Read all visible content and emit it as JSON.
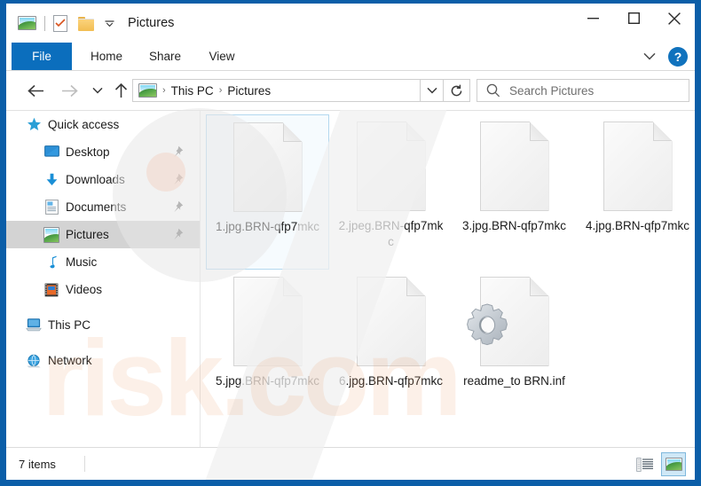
{
  "window": {
    "title": "Pictures",
    "quick_access_toolbar": [
      {
        "name": "pictures-properties-icon",
        "label": "Pictures"
      },
      {
        "name": "properties-icon",
        "label": "Properties"
      },
      {
        "name": "new-folder-icon",
        "label": "New folder"
      },
      {
        "name": "customize-chevron-icon",
        "label": "Customize Quick Access Toolbar"
      }
    ],
    "controls": {
      "minimize": "Minimize",
      "maximize": "Maximize",
      "close": "Close"
    }
  },
  "ribbon": {
    "tabs": [
      {
        "label": "File",
        "selected": true
      },
      {
        "label": "Home",
        "selected": false
      },
      {
        "label": "Share",
        "selected": false
      },
      {
        "label": "View",
        "selected": false
      }
    ],
    "collapse_label": "Minimize the Ribbon",
    "help_label": "?"
  },
  "navigation": {
    "back_label": "Back",
    "forward_label": "Forward",
    "recent_label": "Recent locations",
    "up_label": "Up to This PC",
    "breadcrumbs": [
      "This PC",
      "Pictures"
    ],
    "address_dropdown_label": "Previous locations",
    "refresh_label": "Refresh Pictures",
    "separator": "›"
  },
  "search": {
    "placeholder": "Search Pictures",
    "value": ""
  },
  "sidebar": {
    "items": [
      {
        "label": "Quick access",
        "icon": "star-icon",
        "level": 0,
        "pinned": false,
        "selected": false
      },
      {
        "label": "Desktop",
        "icon": "desktop-icon",
        "level": 1,
        "pinned": true,
        "selected": false
      },
      {
        "label": "Downloads",
        "icon": "downloads-icon",
        "level": 1,
        "pinned": true,
        "selected": false
      },
      {
        "label": "Documents",
        "icon": "documents-icon",
        "level": 1,
        "pinned": true,
        "selected": false
      },
      {
        "label": "Pictures",
        "icon": "pictures-icon",
        "level": 1,
        "pinned": true,
        "selected": true
      },
      {
        "label": "Music",
        "icon": "music-icon",
        "level": 1,
        "pinned": false,
        "selected": false
      },
      {
        "label": "Videos",
        "icon": "videos-icon",
        "level": 1,
        "pinned": false,
        "selected": false
      },
      {
        "label": "This PC",
        "icon": "this-pc-icon",
        "level": 0,
        "pinned": false,
        "selected": false
      },
      {
        "label": "Network",
        "icon": "network-icon",
        "level": 0,
        "pinned": false,
        "selected": false
      }
    ]
  },
  "files": [
    {
      "name": "1.jpg.BRN-qfp7mkc",
      "icon": "blank-document-icon",
      "selected": true
    },
    {
      "name": "2.jpeg.BRN-qfp7mkc",
      "icon": "blank-document-icon",
      "selected": false
    },
    {
      "name": "3.jpg.BRN-qfp7mkc",
      "icon": "blank-document-icon",
      "selected": false
    },
    {
      "name": "4.jpg.BRN-qfp7mkc",
      "icon": "blank-document-icon",
      "selected": false
    },
    {
      "name": "5.jpg.BRN-qfp7mkc",
      "icon": "blank-document-icon",
      "selected": false
    },
    {
      "name": "6.jpg.BRN-qfp7mkc",
      "icon": "blank-document-icon",
      "selected": false
    },
    {
      "name": "readme_to BRN.inf",
      "icon": "inf-gear-document-icon",
      "selected": false
    }
  ],
  "status": {
    "item_count": "7 items",
    "details_view_label": "Details view",
    "large_icons_view_label": "Large icons view",
    "active_view": "large-icons"
  },
  "watermark": {
    "text": "risk.com"
  },
  "colors": {
    "window_border": "#0b5ea8",
    "file_tab": "#0b6ebd",
    "accent": "#1072bd",
    "sidebar_selection": "#d3d3d3",
    "item_selection_border": "#b3d8ef",
    "item_selection_fill": "#f6fbfe",
    "view_button_active": "#cfe8f7"
  }
}
